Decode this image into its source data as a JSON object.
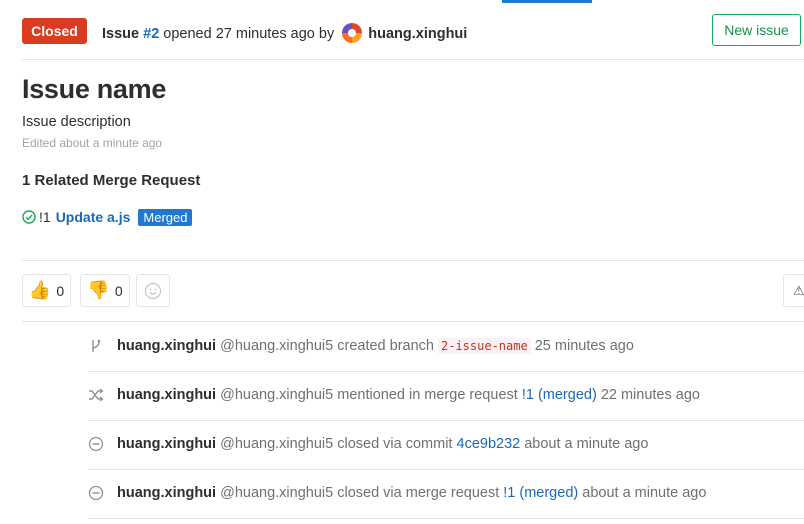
{
  "header": {
    "status": "Closed",
    "issue_prefix": "Issue",
    "issue_ref": "#2",
    "opened_text": "opened 27 minutes ago by",
    "author": "huang.xinghui",
    "new_issue_label": "New issue"
  },
  "issue": {
    "title": "Issue name",
    "description": "Issue description",
    "edited": "Edited about a minute ago"
  },
  "related": {
    "heading": "1 Related Merge Request",
    "item": {
      "ref": "!1",
      "title": "Update a.js",
      "status": "Merged"
    }
  },
  "awards": {
    "thumbsup_count": "0",
    "thumbsdown_count": "0"
  },
  "notes": [
    {
      "icon": "branch-icon",
      "author": "huang.xinghui",
      "handle": "@huang.xinghui5",
      "action": "created branch",
      "ref": "",
      "code": "2-issue-name",
      "time": "25 minutes ago"
    },
    {
      "icon": "shuffle-icon",
      "author": "huang.xinghui",
      "handle": "@huang.xinghui5",
      "action": "mentioned in merge request",
      "ref": "!1 (merged)",
      "code": "",
      "time": "22 minutes ago"
    },
    {
      "icon": "closed-circle-icon",
      "author": "huang.xinghui",
      "handle": "@huang.xinghui5",
      "action": "closed via commit",
      "ref": "4ce9b232",
      "code": "",
      "time": "about a minute ago"
    },
    {
      "icon": "closed-circle-icon",
      "author": "huang.xinghui",
      "handle": "@huang.xinghui5",
      "action": "closed via merge request",
      "ref": "!1 (merged)",
      "code": "",
      "time": "about a minute ago"
    }
  ],
  "colors": {
    "closed": "#db3b21",
    "link": "#1b69b6",
    "merged": "#1f78d1",
    "new_issue": "#1aaa55"
  }
}
